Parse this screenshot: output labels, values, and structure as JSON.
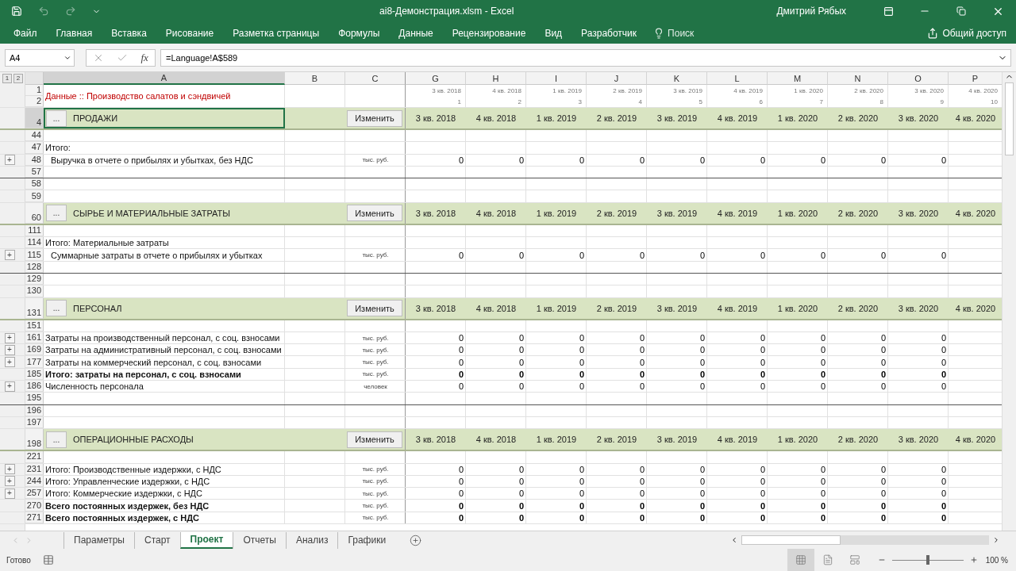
{
  "window": {
    "title": "ai8-Демонстрация.xlsm  -  Excel",
    "user": "Дмитрий Рябых"
  },
  "ribbon": {
    "tabs": [
      "Файл",
      "Главная",
      "Вставка",
      "Рисование",
      "Разметка страницы",
      "Формулы",
      "Данные",
      "Рецензирование",
      "Вид",
      "Разработчик"
    ],
    "search": "Поиск",
    "share": "Общий доступ"
  },
  "formula_bar": {
    "name_box": "A4",
    "fx": "fx",
    "formula": "=Language!A$589"
  },
  "outline_levels": [
    "1",
    "2"
  ],
  "columns": [
    {
      "label": "A",
      "selected": true
    },
    {
      "label": "B",
      "selected": false
    },
    {
      "label": "C",
      "selected": false
    },
    {
      "label": "G",
      "selected": false
    },
    {
      "label": "H",
      "selected": false
    },
    {
      "label": "I",
      "selected": false
    },
    {
      "label": "J",
      "selected": false
    },
    {
      "label": "K",
      "selected": false
    },
    {
      "label": "L",
      "selected": false
    },
    {
      "label": "M",
      "selected": false
    },
    {
      "label": "N",
      "selected": false
    },
    {
      "label": "O",
      "selected": false
    },
    {
      "label": "P",
      "selected": false
    }
  ],
  "title_rows": {
    "rows": [
      "1",
      "2"
    ],
    "title": "Данные :: Производство салатов и сэндвичей",
    "quarters": [
      "3 кв. 2018",
      "4 кв. 2018",
      "1 кв. 2019",
      "2 кв. 2019",
      "3 кв. 2019",
      "4 кв. 2019",
      "1 кв. 2020",
      "2 кв. 2020",
      "3 кв. 2020",
      "4 кв. 2020"
    ],
    "numbers": [
      "1",
      "2",
      "3",
      "4",
      "5",
      "6",
      "7",
      "8",
      "9",
      "10"
    ]
  },
  "rows": [
    {
      "kind": "section",
      "row": "4",
      "selected": true,
      "more": "...",
      "title": "ПРОДАЖИ",
      "button": "Изменить",
      "values": [
        "3 кв. 2018",
        "4 кв. 2018",
        "1 кв. 2019",
        "2 кв. 2019",
        "3 кв. 2019",
        "4 кв. 2019",
        "1 кв. 2020",
        "2 кв. 2020",
        "3 кв. 2020",
        "4 кв. 2020"
      ]
    },
    {
      "kind": "data",
      "row": "44"
    },
    {
      "kind": "data",
      "row": "47",
      "label": "Итого:"
    },
    {
      "kind": "data",
      "row": "48",
      "expand": "+",
      "label": "Выручка в отчете о прибылях и убытках, без НДС",
      "indent": true,
      "unit": "тыс. руб.",
      "values": [
        "0",
        "0",
        "0",
        "0",
        "0",
        "0",
        "0",
        "0",
        "0"
      ]
    },
    {
      "kind": "data",
      "row": "57",
      "rule_below": true
    },
    {
      "kind": "data",
      "row": "58"
    },
    {
      "kind": "data",
      "row": "59"
    },
    {
      "kind": "section",
      "row": "60",
      "selected": false,
      "more": "...",
      "title": "СЫРЬЕ И МАТЕРИАЛЬНЫЕ ЗАТРАТЫ",
      "button": "Изменить",
      "values": [
        "3 кв. 2018",
        "4 кв. 2018",
        "1 кв. 2019",
        "2 кв. 2019",
        "3 кв. 2019",
        "4 кв. 2019",
        "1 кв. 2020",
        "2 кв. 2020",
        "3 кв. 2020",
        "4 кв. 2020"
      ]
    },
    {
      "kind": "data",
      "row": "111"
    },
    {
      "kind": "data",
      "row": "114",
      "label": "Итого: Материальные затраты"
    },
    {
      "kind": "data",
      "row": "115",
      "expand": "+",
      "label": "Суммарные затраты в отчете о прибылях и убытках",
      "indent": true,
      "unit": "тыс. руб.",
      "values": [
        "0",
        "0",
        "0",
        "0",
        "0",
        "0",
        "0",
        "0",
        "0"
      ]
    },
    {
      "kind": "data",
      "row": "128",
      "rule_below": true
    },
    {
      "kind": "data",
      "row": "129"
    },
    {
      "kind": "data",
      "row": "130"
    },
    {
      "kind": "section",
      "row": "131",
      "selected": false,
      "more": "...",
      "title": "ПЕРСОНАЛ",
      "button": "Изменить",
      "values": [
        "3 кв. 2018",
        "4 кв. 2018",
        "1 кв. 2019",
        "2 кв. 2019",
        "3 кв. 2019",
        "4 кв. 2019",
        "1 кв. 2020",
        "2 кв. 2020",
        "3 кв. 2020",
        "4 кв. 2020"
      ]
    },
    {
      "kind": "data",
      "row": "151"
    },
    {
      "kind": "data",
      "row": "161",
      "expand": "+",
      "label": "Затраты на производственный персонал, с соц. взносами",
      "unit": "тыс. руб.",
      "values": [
        "0",
        "0",
        "0",
        "0",
        "0",
        "0",
        "0",
        "0",
        "0"
      ]
    },
    {
      "kind": "data",
      "row": "169",
      "expand": "+",
      "label": "Затраты на административный персонал, с соц. взносами",
      "unit": "тыс. руб.",
      "values": [
        "0",
        "0",
        "0",
        "0",
        "0",
        "0",
        "0",
        "0",
        "0"
      ]
    },
    {
      "kind": "data",
      "row": "177",
      "expand": "+",
      "label": "Затраты на коммерческий персонал, с соц. взносами",
      "unit": "тыс. руб.",
      "values": [
        "0",
        "0",
        "0",
        "0",
        "0",
        "0",
        "0",
        "0",
        "0"
      ]
    },
    {
      "kind": "data",
      "row": "185",
      "bold": true,
      "label": "Итого: затраты на персонал, с соц. взносами",
      "unit": "тыс. руб.",
      "values": [
        "0",
        "0",
        "0",
        "0",
        "0",
        "0",
        "0",
        "0",
        "0"
      ]
    },
    {
      "kind": "data",
      "row": "186",
      "expand": "+",
      "label": "Численность персонала",
      "unit": "человек",
      "values": [
        "0",
        "0",
        "0",
        "0",
        "0",
        "0",
        "0",
        "0",
        "0"
      ]
    },
    {
      "kind": "data",
      "row": "195",
      "rule_below": true
    },
    {
      "kind": "data",
      "row": "196"
    },
    {
      "kind": "data",
      "row": "197"
    },
    {
      "kind": "section",
      "row": "198",
      "selected": false,
      "more": "...",
      "title": "ОПЕРАЦИОННЫЕ РАСХОДЫ",
      "button": "Изменить",
      "values": [
        "3 кв. 2018",
        "4 кв. 2018",
        "1 кв. 2019",
        "2 кв. 2019",
        "3 кв. 2019",
        "4 кв. 2019",
        "1 кв. 2020",
        "2 кв. 2020",
        "3 кв. 2020",
        "4 кв. 2020"
      ]
    },
    {
      "kind": "data",
      "row": "221"
    },
    {
      "kind": "data",
      "row": "231",
      "expand": "+",
      "label": "Итого: Производственные издержки, с НДС",
      "unit": "тыс. руб.",
      "values": [
        "0",
        "0",
        "0",
        "0",
        "0",
        "0",
        "0",
        "0",
        "0"
      ]
    },
    {
      "kind": "data",
      "row": "244",
      "expand": "+",
      "label": "Итого: Управленческие издержки, с НДС",
      "unit": "тыс. руб.",
      "values": [
        "0",
        "0",
        "0",
        "0",
        "0",
        "0",
        "0",
        "0",
        "0"
      ]
    },
    {
      "kind": "data",
      "row": "257",
      "expand": "+",
      "label": "Итого: Коммерческие издержки, с НДС",
      "unit": "тыс. руб.",
      "values": [
        "0",
        "0",
        "0",
        "0",
        "0",
        "0",
        "0",
        "0",
        "0"
      ]
    },
    {
      "kind": "data",
      "row": "270",
      "bold": true,
      "label": "Всего постоянных издержек, без НДС",
      "unit": "тыс. руб.",
      "values": [
        "0",
        "0",
        "0",
        "0",
        "0",
        "0",
        "0",
        "0",
        "0"
      ]
    },
    {
      "kind": "data",
      "row": "271",
      "bold": true,
      "label": "Всего постоянных издержек, с НДС",
      "unit": "тыс. руб.",
      "values": [
        "0",
        "0",
        "0",
        "0",
        "0",
        "0",
        "0",
        "0",
        "0"
      ]
    }
  ],
  "sheet_tabs": [
    {
      "label": "Параметры",
      "selected": false
    },
    {
      "label": "Старт",
      "selected": false
    },
    {
      "label": "Проект",
      "selected": true
    },
    {
      "label": "Отчеты",
      "selected": false
    },
    {
      "label": "Анализ",
      "selected": false
    },
    {
      "label": "Графики",
      "selected": false
    }
  ],
  "status_bar": {
    "status": "Готово",
    "views": [
      {
        "kind": "normal",
        "selected": true
      },
      {
        "kind": "layout",
        "selected": false
      },
      {
        "kind": "pagebreak",
        "selected": false
      }
    ],
    "zoom": {
      "level": 0.5,
      "reading": "100 %"
    }
  }
}
